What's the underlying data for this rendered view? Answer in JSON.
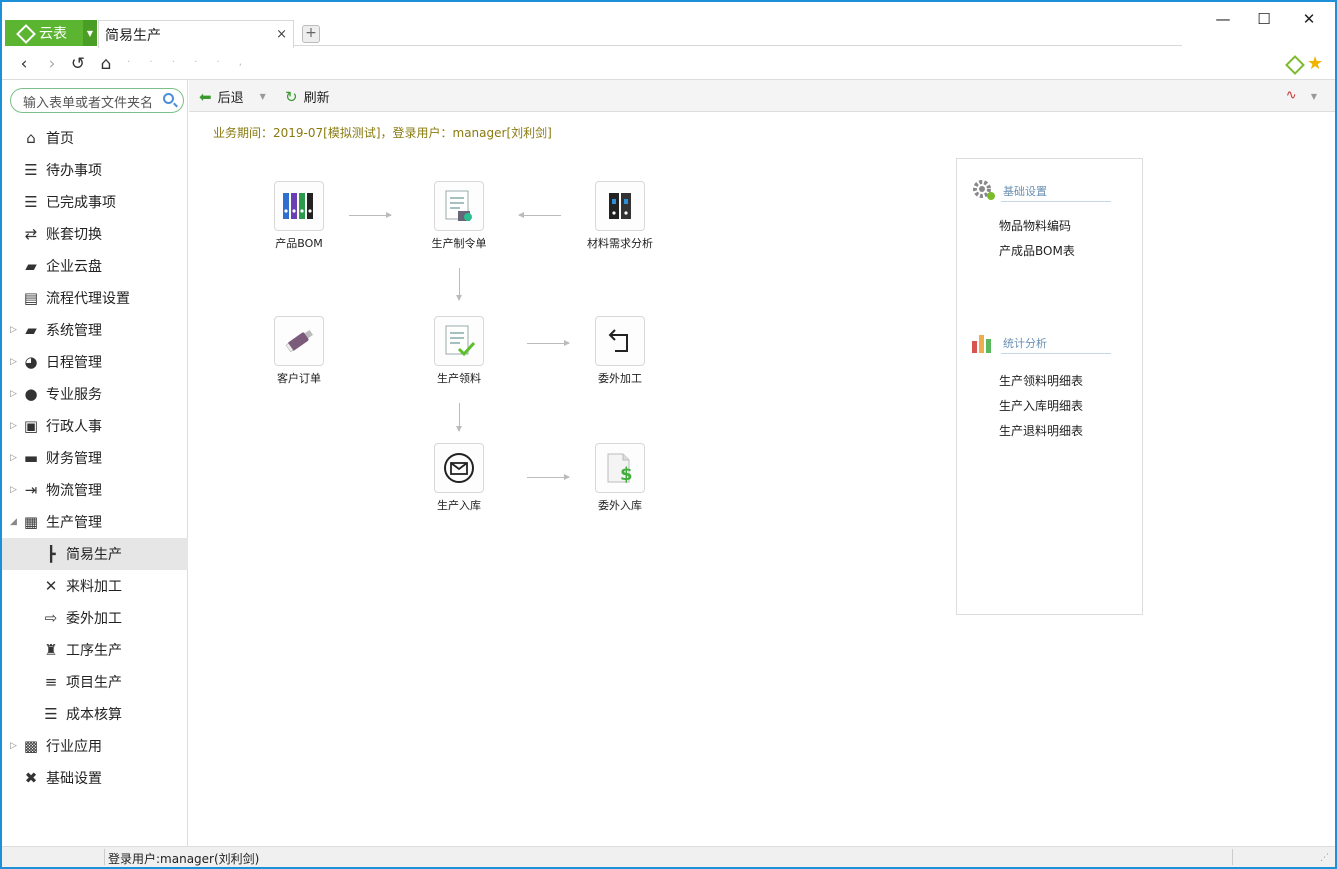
{
  "app": {
    "brand_label": "云表",
    "tab_label": "简易生产",
    "tab_close": "×",
    "tab_add": "+",
    "address_text": "· · · · · ,"
  },
  "window_controls": {
    "minimize": "—",
    "maximize": "☐",
    "close": "✕"
  },
  "search": {
    "placeholder": "输入表单或者文件夹名"
  },
  "sidebar": {
    "items": [
      {
        "label": "首页",
        "icon": "home-icon",
        "glyph": "⌂",
        "level": "top",
        "arrow": ""
      },
      {
        "label": "待办事项",
        "icon": "list-icon",
        "glyph": "☰",
        "level": "top",
        "arrow": ""
      },
      {
        "label": "已完成事项",
        "icon": "list-icon",
        "glyph": "☰",
        "level": "top",
        "arrow": ""
      },
      {
        "label": "账套切换",
        "icon": "switch-icon",
        "glyph": "⇄",
        "level": "top",
        "arrow": ""
      },
      {
        "label": "企业云盘",
        "icon": "folder-icon",
        "glyph": "▰",
        "level": "top",
        "arrow": ""
      },
      {
        "label": "流程代理设置",
        "icon": "document-icon",
        "glyph": "▤",
        "level": "top",
        "arrow": ""
      },
      {
        "label": "系统管理",
        "icon": "folder-icon",
        "glyph": "▰",
        "level": "top",
        "arrow": "▷"
      },
      {
        "label": "日程管理",
        "icon": "user-icon",
        "glyph": "◕",
        "level": "top",
        "arrow": "▷"
      },
      {
        "label": "专业服务",
        "icon": "user-icon",
        "glyph": "●",
        "level": "top",
        "arrow": "▷"
      },
      {
        "label": "行政人事",
        "icon": "contact-icon",
        "glyph": "▣",
        "level": "top",
        "arrow": "▷"
      },
      {
        "label": "财务管理",
        "icon": "wallet-icon",
        "glyph": "▬",
        "level": "top",
        "arrow": "▷"
      },
      {
        "label": "物流管理",
        "icon": "export-icon",
        "glyph": "⇥",
        "level": "top",
        "arrow": "▷"
      },
      {
        "label": "生产管理",
        "icon": "factory-icon",
        "glyph": "▦",
        "level": "top",
        "arrow": "◢"
      },
      {
        "label": "简易生产",
        "icon": "tree-icon",
        "glyph": "┣",
        "level": "sub",
        "arrow": "",
        "active": true
      },
      {
        "label": "来料加工",
        "icon": "tools-icon",
        "glyph": "✕",
        "level": "sub",
        "arrow": ""
      },
      {
        "label": "委外加工",
        "icon": "outsource-icon",
        "glyph": "⇨",
        "level": "sub",
        "arrow": ""
      },
      {
        "label": "工序生产",
        "icon": "hierarchy-icon",
        "glyph": "♜",
        "level": "sub",
        "arrow": ""
      },
      {
        "label": "项目生产",
        "icon": "server-icon",
        "glyph": "≡",
        "level": "sub",
        "arrow": ""
      },
      {
        "label": "成本核算",
        "icon": "list-icon",
        "glyph": "☰",
        "level": "sub",
        "arrow": ""
      },
      {
        "label": "行业应用",
        "icon": "chip-icon",
        "glyph": "▩",
        "level": "top",
        "arrow": "▷"
      },
      {
        "label": "基础设置",
        "icon": "wrench-icon",
        "glyph": "✖",
        "level": "top",
        "arrow": ""
      }
    ]
  },
  "toolbar": {
    "back_label": "后退",
    "refresh_label": "刷新",
    "caret": "▼",
    "right_icon": "∿"
  },
  "main": {
    "period_text": "业务期间：2019-07[模拟测试]，登录用户：manager[刘利剑]",
    "flow_nodes": {
      "bom": "产品BOM",
      "order": "生产制令单",
      "material_analysis": "材料需求分析",
      "customer_order": "客户订单",
      "picking": "生产领料",
      "outsourcing": "委外加工",
      "warehousing": "生产入库",
      "outsource_in": "委外入库"
    },
    "panel": {
      "basic_title": "基础设置",
      "basic_links": [
        "物品物料编码",
        "产成品BOM表"
      ],
      "stats_title": "统计分析",
      "stats_links": [
        "生产领料明细表",
        "生产入库明细表",
        "生产退料明细表"
      ]
    }
  },
  "statusbar": {
    "user_text": "登录用户:manager(刘利剑)",
    "grip": "⋰"
  },
  "colors": {
    "brand_green": "#5cb531",
    "window_border": "#1e90d8",
    "period_text": "#8a7a10",
    "panel_heading": "#6a8fb3"
  }
}
